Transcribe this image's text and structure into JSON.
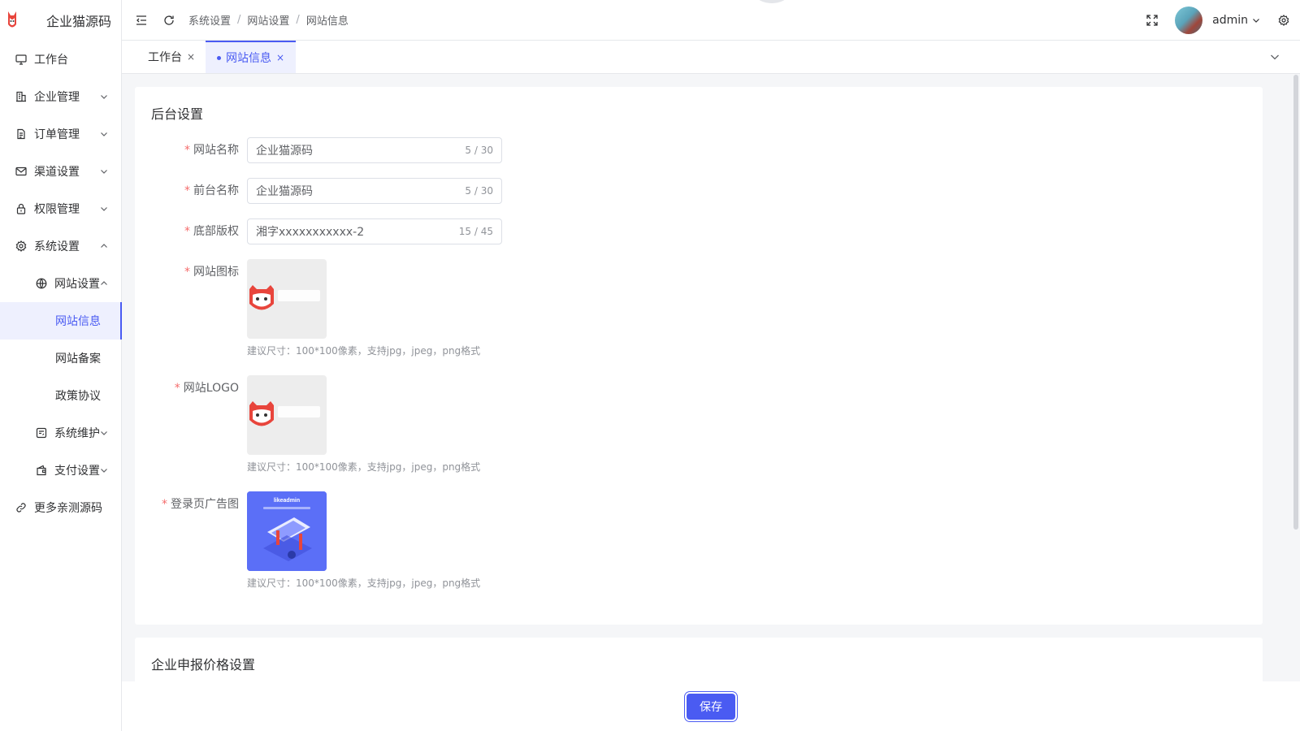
{
  "app": {
    "name": "企业猫源码"
  },
  "sidebar": {
    "items": [
      {
        "label": "工作台",
        "icon": "monitor-icon"
      },
      {
        "label": "企业管理",
        "icon": "building-icon"
      },
      {
        "label": "订单管理",
        "icon": "document-icon"
      },
      {
        "label": "渠道设置",
        "icon": "mail-icon"
      },
      {
        "label": "权限管理",
        "icon": "lock-icon"
      },
      {
        "label": "系统设置",
        "icon": "gear-icon"
      },
      {
        "label": "网站设置",
        "icon": "globe-icon"
      },
      {
        "label": "网站信息"
      },
      {
        "label": "网站备案"
      },
      {
        "label": "政策协议"
      },
      {
        "label": "系统维护",
        "icon": "maintenance-icon"
      },
      {
        "label": "支付设置",
        "icon": "wallet-icon"
      },
      {
        "label": "更多亲测源码",
        "icon": "link-icon"
      }
    ]
  },
  "header": {
    "breadcrumb": [
      "系统设置",
      "网站设置",
      "网站信息"
    ],
    "separator": "/",
    "username": "admin"
  },
  "tabs": [
    {
      "label": "工作台",
      "close": "×"
    },
    {
      "label": "网站信息",
      "close": "×",
      "active": true
    }
  ],
  "form": {
    "section_title": "后台设置",
    "fields": [
      {
        "label": "网站名称",
        "value": "企业猫源码",
        "count": "5 / 30"
      },
      {
        "label": "前台名称",
        "value": "企业猫源码",
        "count": "5 / 30"
      },
      {
        "label": "底部版权",
        "value": "湘字xxxxxxxxxxx-2",
        "count": "15 / 45"
      }
    ],
    "uploads": [
      {
        "label": "网站图标",
        "tip": "建议尺寸：100*100像素，支持jpg，jpeg，png格式"
      },
      {
        "label": "网站LOGO",
        "tip": "建议尺寸：100*100像素，支持jpg，jpeg，png格式"
      },
      {
        "label": "登录页广告图",
        "tip": "建议尺寸：100*100像素，支持jpg，jpeg，png格式",
        "banner_title": "likeadmin"
      }
    ],
    "required_mark": "*"
  },
  "section2": {
    "title": "企业申报价格设置"
  },
  "footer": {
    "save_label": "保存"
  },
  "colors": {
    "primary": "#4a5bf2",
    "required": "#f56c6c",
    "brand_red": "#e8453c"
  }
}
